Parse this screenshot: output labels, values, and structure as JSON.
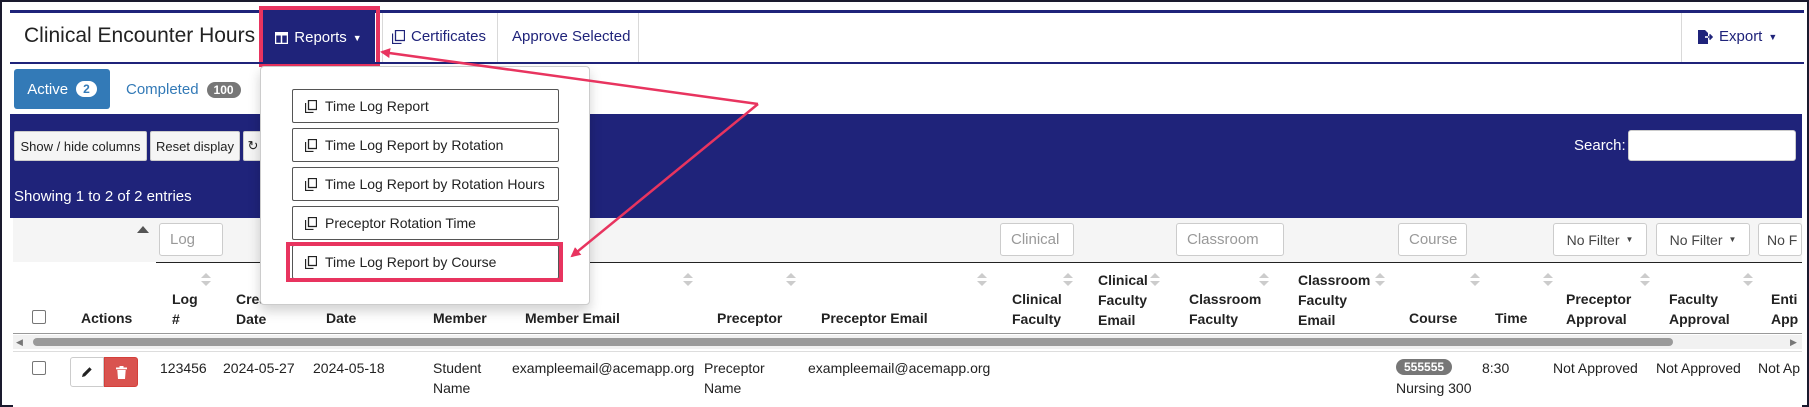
{
  "app": {
    "title": "Clinical Encounter Hours",
    "nav": {
      "reports": "Reports",
      "certificates": "Certificates",
      "approve": "Approve Selected",
      "export": "Export"
    }
  },
  "tabs": [
    {
      "label": "Active",
      "count": "2"
    },
    {
      "label": "Completed",
      "count": "100"
    }
  ],
  "toolbar": {
    "show_hide": "Show / hide columns",
    "reset": "Reset display",
    "search_label": "Search:",
    "search_value": ""
  },
  "info": {
    "showing": "Showing 1 to 2 of 2 entries"
  },
  "reports_menu": {
    "items": [
      "Time Log Report",
      "Time Log Report by Rotation",
      "Time Log Report by Rotation Hours",
      "Preceptor Rotation Time",
      "Time Log Report by Course"
    ]
  },
  "filters": {
    "log": "Log",
    "clinical": "Clinical",
    "classroom": "Classroom",
    "course": "Course",
    "no_filter": "No Filter",
    "no_f": "No F"
  },
  "table": {
    "headers": {
      "actions": "Actions",
      "log": [
        "Log",
        "#"
      ],
      "created": [
        "Crea",
        "Date"
      ],
      "date": "Date",
      "member": "Member",
      "member_email": "Member Email",
      "preceptor": "Preceptor",
      "preceptor_email": "Preceptor Email",
      "clinical_faculty": [
        "Clinical",
        "Faculty"
      ],
      "clinical_faculty_email": [
        "Clinical",
        "Faculty",
        "Email"
      ],
      "classroom_faculty": [
        "Classroom",
        "Faculty"
      ],
      "classroom_faculty_email": [
        "Classroom",
        "Faculty",
        "Email"
      ],
      "course": "Course",
      "time": "Time",
      "preceptor_approval": [
        "Preceptor",
        "Approval"
      ],
      "faculty_approval": [
        "Faculty",
        "Approval"
      ],
      "entity_approval": [
        "Enti",
        "App"
      ]
    },
    "rows": [
      {
        "log": "123456",
        "created": "2024-05-27",
        "date": "2024-05-18",
        "member": [
          "Student",
          "Name"
        ],
        "member_email": "exampleemail@acemapp.org",
        "preceptor": [
          "Preceptor",
          "Name"
        ],
        "preceptor_email": "exampleemail@acemapp.org",
        "course_code": "555555",
        "course_name": "Nursing 300",
        "time": "8:30",
        "preceptor_approval": "Not Approved",
        "faculty_approval": "Not Approved",
        "entity_approval": "Not Ap"
      }
    ]
  },
  "colors": {
    "navy": "#1f237a",
    "accent": "#e8345f",
    "primary": "#337ab7",
    "danger": "#d9534f"
  }
}
